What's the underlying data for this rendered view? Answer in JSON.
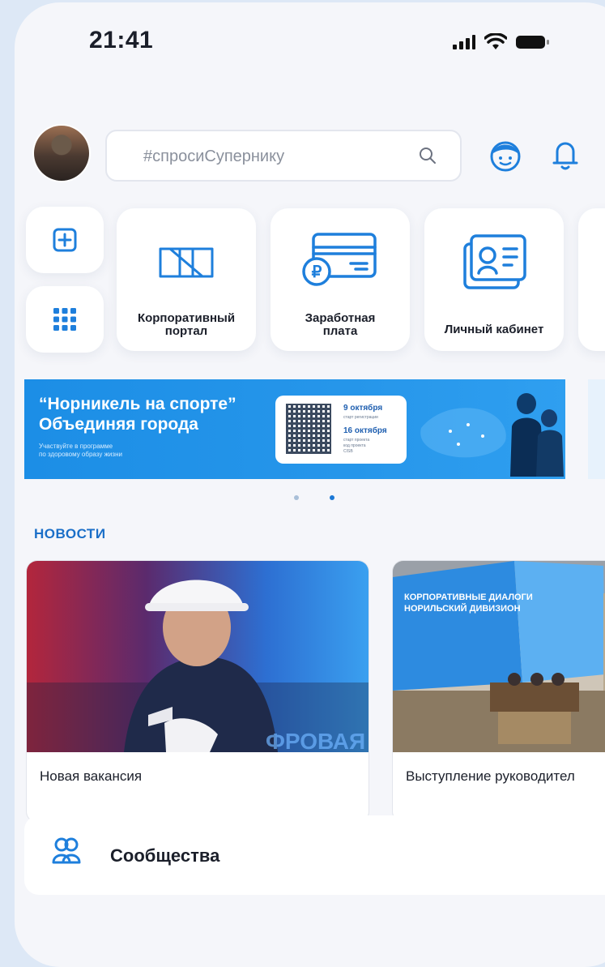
{
  "status": {
    "time": "21:41"
  },
  "search": {
    "placeholder": "#спросиСупернику"
  },
  "tiles": [
    {
      "label": "Корпоративный\nпортал",
      "icon": "nornickel-logo-icon"
    },
    {
      "label": "Заработная\nплата",
      "icon": "salary-card-icon"
    },
    {
      "label": "Личный кабинет",
      "icon": "id-card-icon"
    }
  ],
  "banner": {
    "title_line1": "“Норникель на спорте”",
    "title_line2": "Объединяя города",
    "subtitle_line1": "Участвуйте в программе",
    "subtitle_line2": "по здоровому образу жизни",
    "date1": "9 октября",
    "date1_note": "старт регистрации",
    "date2": "16 октября",
    "date2_note": "старт проекта",
    "code_label": "код проекта",
    "code": "CISB"
  },
  "carousel": {
    "active_index": 1,
    "count": 2
  },
  "news": {
    "title": "НОВОСТИ",
    "items": [
      {
        "caption": "Новая вакансия",
        "image": "worker-photo"
      },
      {
        "caption": "Выступление руководител",
        "image": "conference-photo"
      }
    ]
  },
  "communities": {
    "label": "Сообщества"
  }
}
